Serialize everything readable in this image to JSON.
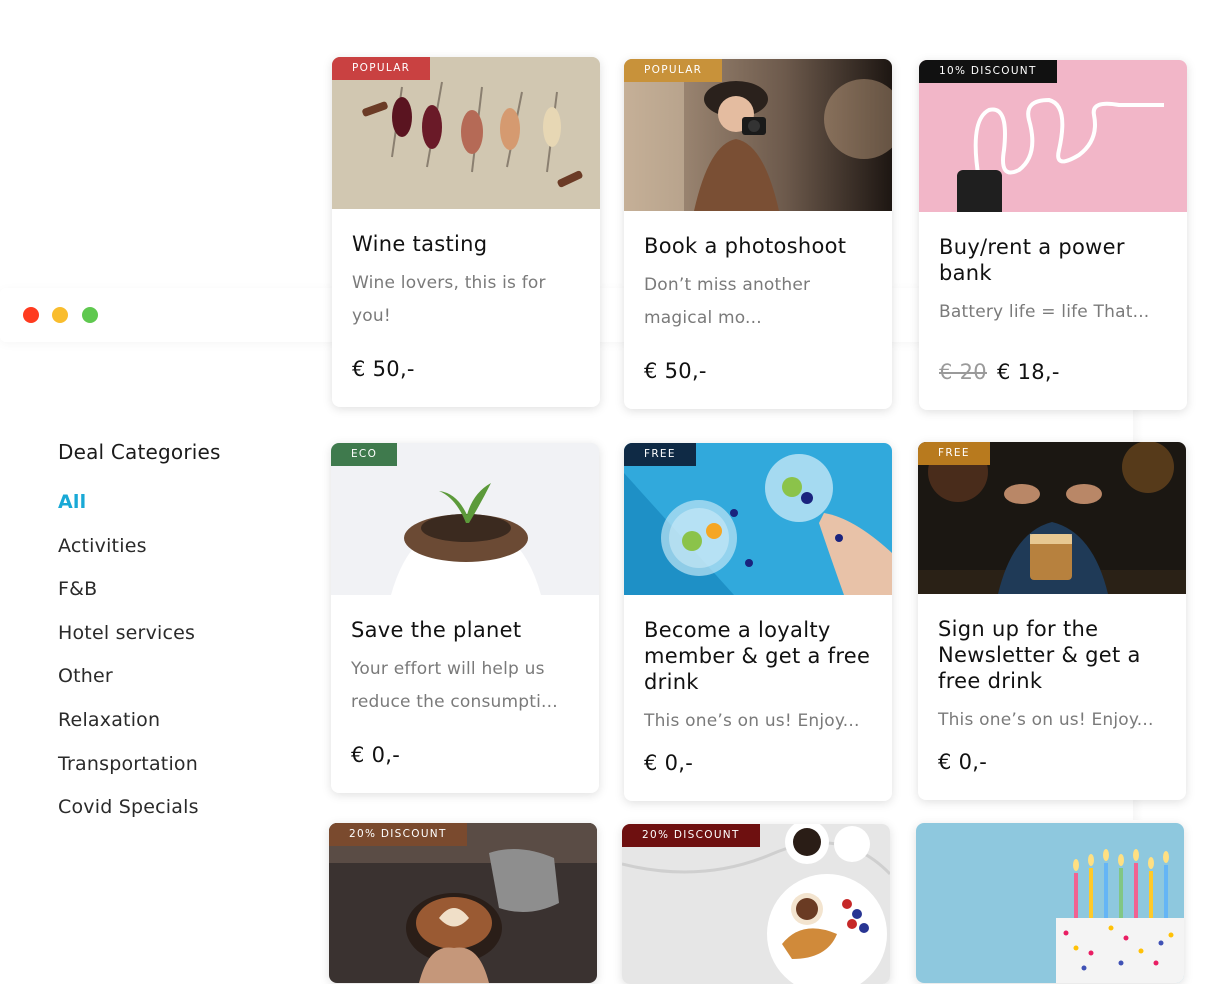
{
  "window": {
    "dots": [
      "close",
      "minimize",
      "maximize"
    ]
  },
  "sidebar": {
    "heading": "Deal Categories",
    "items": [
      {
        "label": "All",
        "active": true
      },
      {
        "label": "Activities"
      },
      {
        "label": "F&B"
      },
      {
        "label": "Hotel services"
      },
      {
        "label": "Other"
      },
      {
        "label": "Relaxation"
      },
      {
        "label": "Transportation"
      },
      {
        "label": "Covid Specials"
      }
    ]
  },
  "cards": [
    {
      "tag": "POPULAR",
      "tag_color": "#c94141",
      "title": "Wine tasting",
      "desc": "Wine lovers, this is for you!",
      "price": "€ 50,-"
    },
    {
      "tag": "POPULAR",
      "tag_color": "#c8923a",
      "title": "Book a photoshoot",
      "desc": "Don’t miss another magical mo...",
      "price": "€ 50,-"
    },
    {
      "tag": "10% DISCOUNT",
      "tag_color": "#111111",
      "title": "Buy/rent a power bank",
      "desc": "Battery life = life That...",
      "old_price": "€ 20",
      "price": "€ 18,-"
    },
    {
      "tag": "ECO",
      "tag_color": "#3f7a4d",
      "title": "Save the planet",
      "desc": "Your effort will help us reduce the consumpti...",
      "price": "€ 0,-"
    },
    {
      "tag": "FREE",
      "tag_color": "#0f2a45",
      "title": "Become a loyalty member & get a free drink",
      "desc": "This one’s on us! Enjoy...",
      "price": "€ 0,-"
    },
    {
      "tag": "FREE",
      "tag_color": "#b87a1e",
      "title": "Sign up for the Newsletter & get a free drink",
      "desc": "This one’s on us! Enjoy...",
      "price": "€ 0,-"
    },
    {
      "tag": "20% DISCOUNT",
      "tag_color": "#7a4a2e"
    },
    {
      "tag": "20% DISCOUNT",
      "tag_color": "#6e1010"
    },
    {
      "tag": ""
    }
  ]
}
